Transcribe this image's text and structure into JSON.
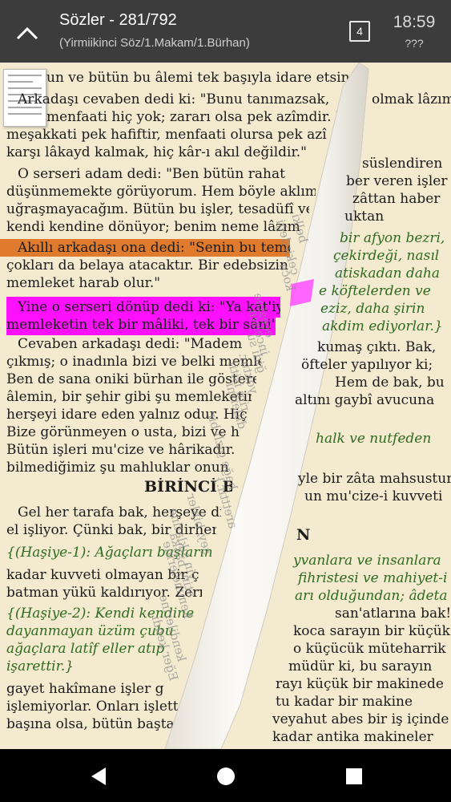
{
  "header": {
    "title": "Sözler - 281/792",
    "subtitle": "(Yirmiikinci Söz/1.Makam/1.Bürhan)",
    "tab_count": "4",
    "time": "18:59",
    "status": "???"
  },
  "left_lines": [
    "un ve bütün bu âlemi tek başıyla idare etsin.\"",
    "Arkadaşı cevaben dedi ki: \"Bunu tanımazsak,",
    "menfaati hiç yok; zararı olsa pek azîmdir. Eğer tan",
    "meşakkati pek hafiftir, menfaati olursa pek azîmd",
    "karşı lâkayd kalmak, hiç kâr-ı akıl değildir.\"",
    "O serseri adam dedi: \"Ben bütün rahat",
    "düşünmemekte görüyorum. Hem böyle aklıma",
    "uğraşmayacağım. Bütün bu işler, tesadüfî ve",
    "kendi kendine dönüyor; benim neme lâzım.\"",
    "Akıllı arkadaşı ona dedi: \"Senin bu teme",
    "çokları da belaya atacaktır. Bir edebsizin yüzü",
    "memleket harab olur.\"",
    "Yine o serseri dönüp dedi ki: \"Ya kat'iyyen",
    "memleketin tek bir mâliki, tek bir sâni'i var",
    "Cevaben arkadaşı dedi: \"Madem ",
    "çıkmış; o inadınla bizi ve belki memleke",
    "Ben de sana oniki bürhan ile göstere",
    "âlemin, bir şehir gibi şu memleketin,",
    "herşeyi idare eden yalnız odur. Hiç",
    "Bize görünmeyen o usta, bizi ve h",
    "Bütün işleri mu'cize ve hârikadır. Bi",
    "bilmediğimiz şu mahluklar onun me"
  ],
  "heading": "BİRİNCİ B",
  "left_lines2": [
    "Gel her tarafa bak, herşeye dikk",
    "el işliyor. Çünki bak, bir dirhem",
    "{(Haşiye-1): Ağaçları başlarınd",
    "kadar kuvveti olmayan bir ç",
    "batman yükü kaldırıyor. Zerre",
    "{(Haşiye-2): Kendi kendine",
    "dayanmayan üzüm çubu",
    "ağaçlara latîf eller atıp",
    "işarettir.}",
    "gayet hakîmane işler g",
    "işlemiyorlar. Onları işlett",
    "başına olsa, bütün baştan başa d"
  ],
  "right_lines": [
    "olmak lâzım",
    "süslendiren",
    "ber veren işler",
    "zâttan haber",
    "uktan",
    "bir afyon bezri,",
    "çekirdeği, nasıl",
    "atiskadan daha",
    "e köftelerden ve",
    "eziz, daha şirin",
    "akdim ediyorlar.}",
    "kumaş çıktı. Bak,",
    "öfteler yapılıyor ki;",
    "Hem de bak, bu",
    "altını gaybî avucuna",
    "halk ve nutfeden",
    "yle bir zâta mahsustur",
    "un mu'cize-i kuvveti",
    "N",
    "yvanlara ve insanlara",
    "fihristesi ve mahiyet-i",
    "arı olduğundan; âdeta",
    "san'atlarına bak!",
    "koca sarayın bir küçük",
    "o küçücük müteharrik",
    "müdür ki, bu sarayın",
    "rayı küçük bir makinede",
    "tu kadar bir makine",
    "veyahut abes bir iş içinde",
    "kadar antika makineler"
  ],
  "curl_lines": [
    "belki",
    "çekirdeği",
    "koca",
    "ecesine",
    "incelsin.",
    "ğidi su",
    "yoktur.",
    "rini işitir",
    "dillerini",
    "bağe gizli bir",
    "aretttir.}",
    "şey, binler",
    "yin sıklatine",
    "atin, başka",
    "kemmelerine",
    "kendilerine",
    "Eğer kendi"
  ],
  "colors": {
    "page_bg": "#f4ead0",
    "highlight_magenta": "#ff10ff",
    "highlight_orange": "#e07b2e",
    "green_text": "#2e6b1f",
    "appbar_bg": "#3c3c3c"
  }
}
